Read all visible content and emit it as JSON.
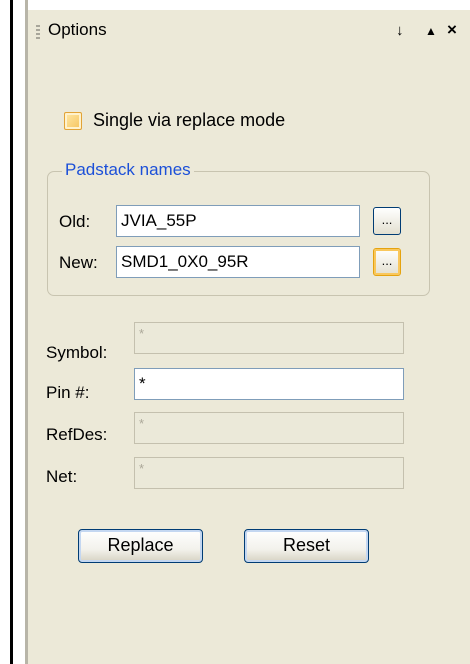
{
  "window": {
    "title": "Options",
    "pin_glyph": "↓",
    "up_glyph": "▲",
    "close_glyph": "×"
  },
  "options": {
    "single_via_label": "Single via replace mode",
    "single_via_checked": false
  },
  "padstack": {
    "legend": "Padstack names",
    "old_label": "Old:",
    "old_value": "JVIA_55P",
    "new_label": "New:",
    "new_value": "SMD1_0X0_95R",
    "browse_label": "..."
  },
  "filters": {
    "symbol_label": "Symbol:",
    "symbol_value": "*",
    "pin_label": "Pin #:",
    "pin_value": "*",
    "refdes_label": "RefDes:",
    "refdes_value": "*",
    "net_label": "Net:",
    "net_value": "*"
  },
  "buttons": {
    "replace_label": "Replace",
    "reset_label": "Reset"
  },
  "colors": {
    "panel_bg": "#ece9d8",
    "group_legend": "#1c50d8",
    "focus_accent": "#f9c75c"
  }
}
